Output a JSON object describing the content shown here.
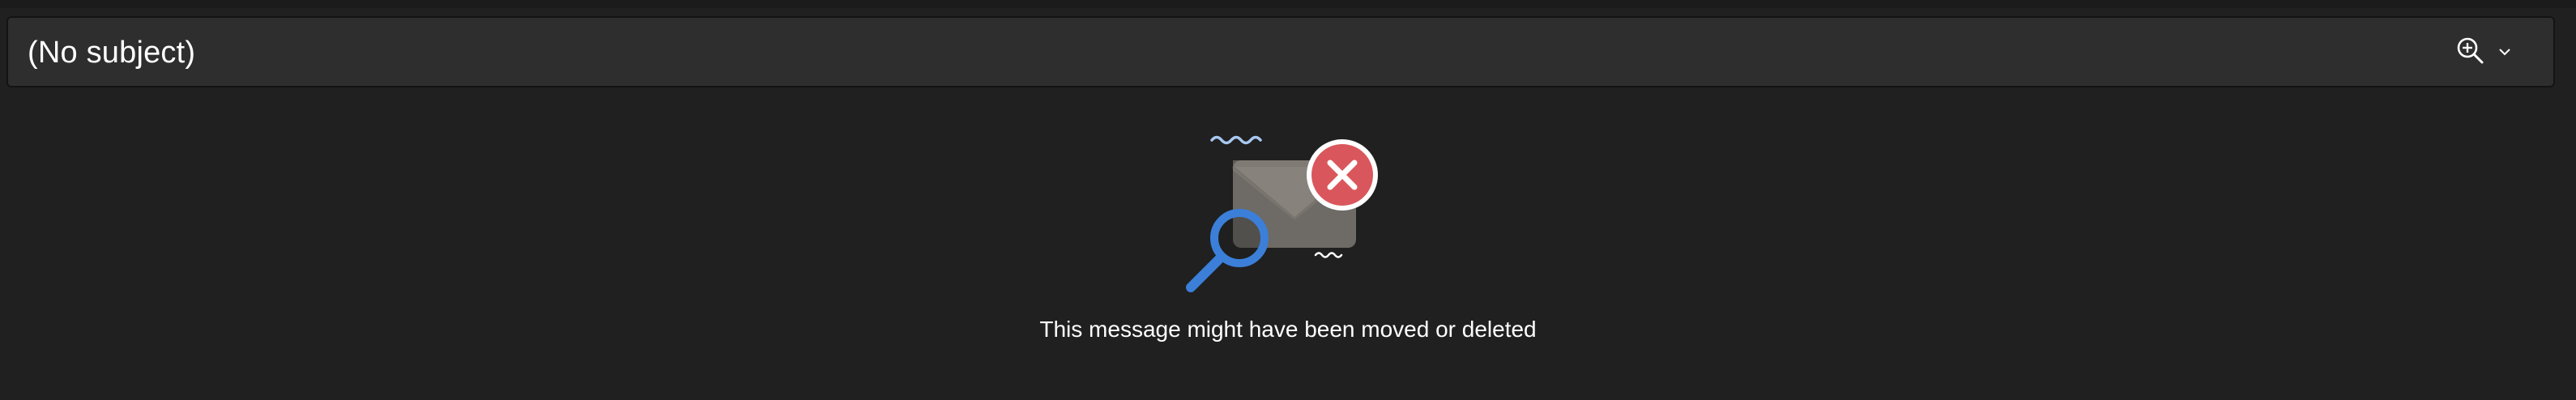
{
  "header": {
    "subject": "(No subject)",
    "zoom_icon": "zoom-in-icon",
    "dropdown_icon": "chevron-down-icon"
  },
  "empty_state": {
    "illustration": "envelope-missing-illustration",
    "message": "This message might have been moved or deleted"
  },
  "colors": {
    "background": "#202020",
    "header_background": "#2e2e2e",
    "text": "#ffffff",
    "error_badge": "#d9575c",
    "magnifier": "#3b7fd9",
    "envelope": "#706c66",
    "squiggle": "#a8c8f0"
  }
}
